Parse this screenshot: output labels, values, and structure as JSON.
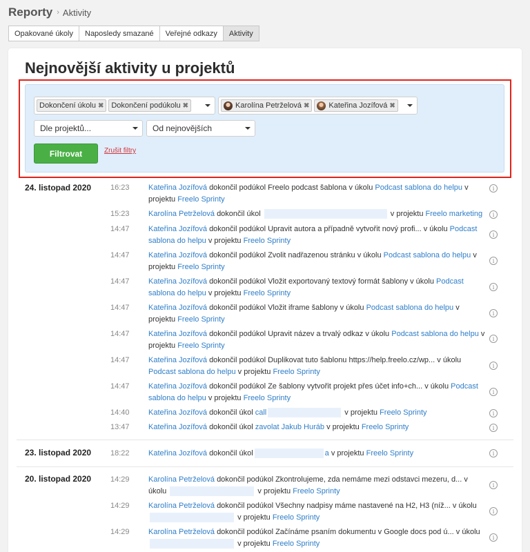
{
  "breadcrumb": {
    "title": "Reporty",
    "current": "Aktivity"
  },
  "tabs": [
    "Opakované úkoly",
    "Naposledy smazané",
    "Veřejné odkazy",
    "Aktivity"
  ],
  "page_title": "Nejnovější aktivity u projektů",
  "filters": {
    "type_tags": [
      "Dokončení úkolu",
      "Dokončení podúkolu"
    ],
    "user_tags": [
      "Karolína Petrželová",
      "Kateřina Jozífová"
    ],
    "project_select": "Dle projektů...",
    "order_select": "Od nejnovějších",
    "submit_label": "Filtrovat",
    "clear_label": "Zrušit filtry",
    "tag_remove_glyph": "✖"
  },
  "info_glyph": "i",
  "words": {
    "done_sub": "dokončil podúkol",
    "done_task": "dokončil úkol",
    "in_task": "v úkolu",
    "in_project": "v projektu"
  },
  "groups": [
    {
      "date": "24. listopad 2020",
      "rows": [
        {
          "time": "16:23",
          "user": "Kateřina Jozífová",
          "item": "Freelo podcast šablona",
          "task_pre": "v úkolu",
          "task": "Podcast sablona do helpu",
          "project_pre": "v projektu",
          "project": "Freelo Sprinty"
        },
        {
          "time": "15:23",
          "user": "Karolína Petrželová",
          "item": "",
          "task_pre": "",
          "task": "",
          "project_pre": "v projektu",
          "project": "Freelo marketing"
        },
        {
          "time": "14:47",
          "user": "Kateřina Jozífová",
          "item": "Upravit autora a případně vytvořit nový profi...",
          "task_pre": "v úkolu",
          "task": "Podcast sablona do helpu",
          "project_pre": "v projektu",
          "project": "Freelo Sprinty"
        },
        {
          "time": "14:47",
          "user": "Kateřina Jozífová",
          "item": "Zvolit nadřazenou stránku",
          "task_pre": "v úkolu",
          "task": "Podcast sablona do helpu",
          "project_pre": "v projektu",
          "project": "Freelo Sprinty"
        },
        {
          "time": "14:47",
          "user": "Kateřina Jozífová",
          "item": "Vložit exportovaný textový formát šablony",
          "task_pre": "v úkolu",
          "task": "Podcast sablona do helpu",
          "project_pre": "v projektu",
          "project": "Freelo Sprinty"
        },
        {
          "time": "14:47",
          "user": "Kateřina Jozífová",
          "item": "Vložit iframe šablony",
          "task_pre": "v úkolu",
          "task": "Podcast sablona do helpu",
          "project_pre": "v projektu",
          "project": "Freelo Sprinty"
        },
        {
          "time": "14:47",
          "user": "Kateřina Jozífová",
          "item": "Upravit název a trvalý odkaz",
          "task_pre": "v úkolu",
          "task": "Podcast sablona do helpu",
          "project_pre": "v projektu",
          "project": "Freelo Sprinty"
        },
        {
          "time": "14:47",
          "user": "Kateřina Jozífová",
          "item": "Duplikovat tuto šablonu https://help.freelo.cz/wp...",
          "task_pre": "v úkolu",
          "task": "Podcast sablona do helpu",
          "project_pre": "v projektu",
          "project": "Freelo Sprinty"
        },
        {
          "time": "14:47",
          "user": "Kateřina Jozífová",
          "item": "Ze šablony vytvořit projekt přes účet info+ch...",
          "task_pre": "v úkolu",
          "task": "Podcast sablona do helpu",
          "project_pre": "v projektu",
          "project": "Freelo Sprinty"
        },
        {
          "time": "14:40",
          "user": "Kateřina Jozífová",
          "item": "call",
          "task_pre": "",
          "task": "",
          "project_pre": "v projektu",
          "project": "Freelo Sprinty"
        },
        {
          "time": "13:47",
          "user": "Kateřina Jozífová",
          "item": "zavolat Jakub Huráb",
          "task_pre": "",
          "task": "",
          "project_pre": "v projektu",
          "project": "Freelo Sprinty"
        }
      ]
    },
    {
      "date": "23. listopad 2020",
      "rows": [
        {
          "time": "18:22",
          "user": "Kateřina Jozífová",
          "item": "a",
          "task_pre": "",
          "task": "",
          "project_pre": "v projektu",
          "project": "Freelo Sprinty"
        }
      ]
    },
    {
      "date": "20. listopad 2020",
      "rows": [
        {
          "time": "14:29",
          "user": "Karolína Petrželová",
          "item": "Zkontrolujeme, zda nemáme mezi odstavci mezeru, d...",
          "task_pre": "v úkolu",
          "task": "",
          "project_pre": "v projektu",
          "project": "Freelo Sprinty"
        },
        {
          "time": "14:29",
          "user": "Karolína Petrželová",
          "item": "Všechny nadpisy máme nastavené na H2, H3 (níž...",
          "task_pre": "v úkolu",
          "task": "",
          "project_pre": "v projektu",
          "project": "Freelo Sprinty"
        },
        {
          "time": "14:29",
          "user": "Karolína Petrželová",
          "item": "Začínáme psaním dokumentu v Google docs pod ú...",
          "task_pre": "v úkolu",
          "task": "",
          "project_pre": "v projektu",
          "project": "Freelo Sprinty"
        }
      ]
    }
  ],
  "colors": {
    "link": "#2f7ec8",
    "filter_panel": "#e0eefb",
    "highlight_border": "#e2231a",
    "button": "#4ab046"
  }
}
